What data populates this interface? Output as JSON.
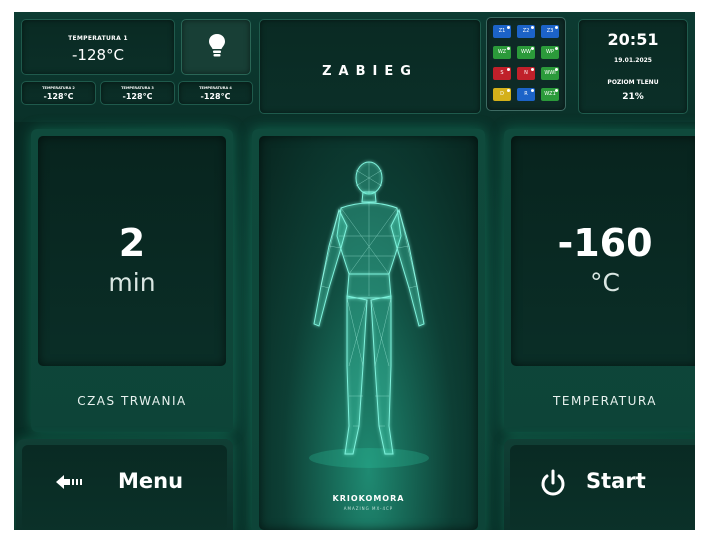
{
  "header": {
    "temp_main": {
      "label": "TEMPERATURA 1",
      "value": "-128°C"
    },
    "temps_small": [
      {
        "label": "TEMPERATURA 2",
        "value": "-128°C"
      },
      {
        "label": "TEMPERATURA 3",
        "value": "-128°C"
      },
      {
        "label": "TEMPERATURA 4",
        "value": "-128°C"
      }
    ],
    "light_icon": "lightbulb-icon",
    "mode_title": "ZABIEG",
    "zones": [
      {
        "label": "Z1",
        "color": "#1c63c8"
      },
      {
        "label": "Z2",
        "color": "#1c63c8"
      },
      {
        "label": "Z3",
        "color": "#1c63c8"
      },
      {
        "label": "WZ",
        "color": "#2b9a3a"
      },
      {
        "label": "WW",
        "color": "#2b9a3a"
      },
      {
        "label": "WP",
        "color": "#2b9a3a"
      },
      {
        "label": "S",
        "color": "#c0202a"
      },
      {
        "label": "N",
        "color": "#c0202a"
      },
      {
        "label": "WWI",
        "color": "#2b9a3a"
      },
      {
        "label": "D",
        "color": "#d4b01a"
      },
      {
        "label": "R",
        "color": "#1c63c8"
      },
      {
        "label": "WZ1",
        "color": "#2b9a3a"
      }
    ],
    "clock": {
      "time": "20:51",
      "date": "19.01.2025",
      "oxygen_label": "POZIOM TLENU",
      "oxygen_value": "21%"
    }
  },
  "duration": {
    "value": "2",
    "unit": "min",
    "caption": "CZAS TRWANIA"
  },
  "temperature": {
    "value": "-160",
    "unit": "°C",
    "caption": "TEMPERATURA"
  },
  "center": {
    "logo": "KRIOKOMORA",
    "tagline": "AMAZING MX-4CP",
    "figure_icon": "human-body-wireframe-icon"
  },
  "buttons": {
    "menu_label": "Menu",
    "menu_icon": "back-arrow-icon",
    "start_label": "Start",
    "start_icon": "power-icon"
  }
}
